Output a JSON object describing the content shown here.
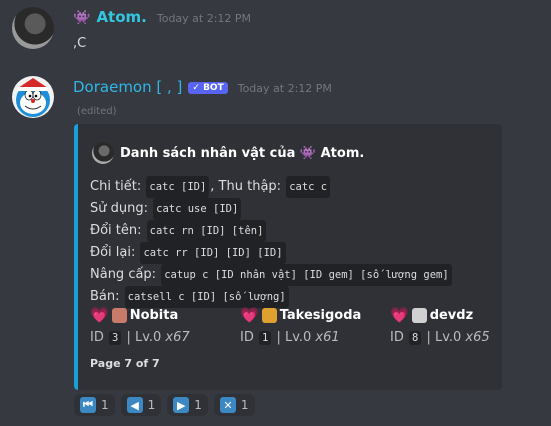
{
  "msg1": {
    "author_emoji": "👾",
    "author": "Atom.",
    "timestamp": "Today at 2:12 PM",
    "text": ",C"
  },
  "msg2": {
    "author": "Doraemon [ , ]",
    "bot_badge": "✓ BOT",
    "timestamp": "Today at 2:12 PM",
    "edited": "(edited)"
  },
  "embed": {
    "color": "#1aa0d8",
    "title": "Danh sách nhân vật của 👾 Atom.",
    "desc": [
      {
        "parts": [
          {
            "t": "Chi tiết: "
          },
          {
            "c": "catc [ID]"
          },
          {
            "t": ", Thu thập: "
          },
          {
            "c": "catc c"
          }
        ]
      },
      {
        "parts": [
          {
            "t": "Sử dụng: "
          },
          {
            "c": "catc use [ID]"
          }
        ]
      },
      {
        "parts": [
          {
            "t": "Đổi tên: "
          },
          {
            "c": "catc rn [ID] [tên]"
          }
        ]
      },
      {
        "parts": [
          {
            "t": "Đổi lại: "
          },
          {
            "c": "catc rr [ID] [ID] [ID]"
          }
        ]
      },
      {
        "parts": [
          {
            "t": "Nâng cấp: "
          },
          {
            "c": "catup c [ID nhân vật] [ID gem] [số lượng gem]"
          }
        ]
      },
      {
        "parts": [
          {
            "t": "Bán: "
          },
          {
            "c": "catsell c [ID] [số lượng]"
          }
        ]
      }
    ],
    "fields": [
      {
        "name": "Nobita",
        "id_label": "ID",
        "id": "3",
        "level": "| Lv.0",
        "count": "x67",
        "icon_color": "#c97b6b"
      },
      {
        "name": "Takesigoda",
        "id_label": "ID",
        "id": "1",
        "level": "| Lv.0",
        "count": "x61",
        "icon_color": "#e0a030"
      },
      {
        "name": "devdz",
        "id_label": "ID",
        "id": "8",
        "level": "| Lv.0",
        "count": "x65",
        "icon_color": "#d0d0d0"
      }
    ],
    "heart": "💗",
    "footer": "Page 7 of 7"
  },
  "reactions": [
    {
      "icon": "⏮",
      "count": "1"
    },
    {
      "icon": "◀",
      "count": "1"
    },
    {
      "icon": "▶",
      "count": "1"
    },
    {
      "icon": "✕",
      "count": "1"
    }
  ]
}
